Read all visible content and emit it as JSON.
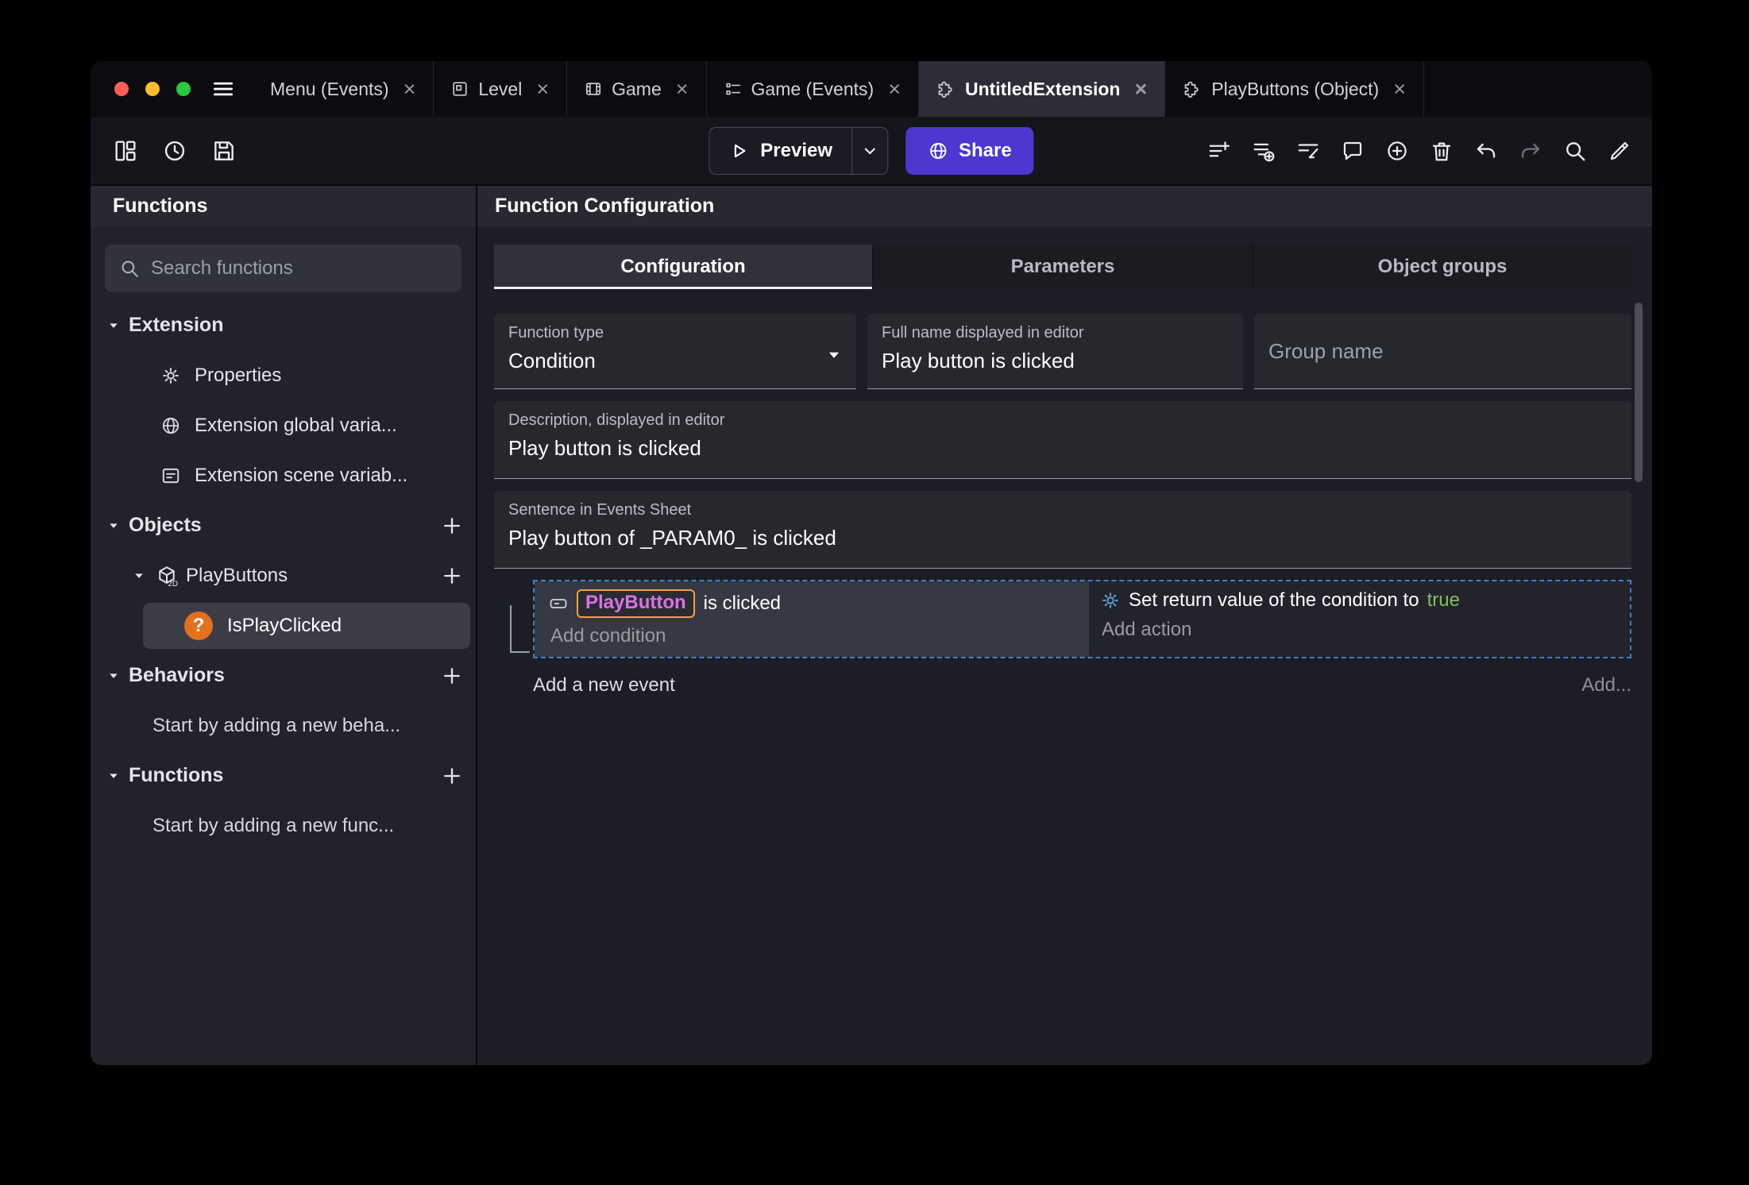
{
  "glyphs": {
    "close": "×",
    "question": "?",
    "two_d": "2D"
  },
  "colors": {
    "accent": "#4A38D0",
    "selection_blue": "#4A90D9",
    "chip_border": "#EEA43E",
    "chip_text": "#D873E2",
    "true_green": "#7FC05F"
  },
  "titlebar": {
    "tabs": [
      {
        "label": "Menu (Events)"
      },
      {
        "label": "Level"
      },
      {
        "label": "Game"
      },
      {
        "label": "Game (Events)"
      },
      {
        "label": "UntitledExtension"
      },
      {
        "label": "PlayButtons (Object)"
      }
    ]
  },
  "toolbar": {
    "preview": "Preview",
    "share": "Share"
  },
  "sidebar": {
    "header": "Functions",
    "search_placeholder": "Search functions",
    "tree": {
      "extension": "Extension",
      "properties": "Properties",
      "global_vars": "Extension global varia...",
      "scene_vars": "Extension scene variab...",
      "objects": "Objects",
      "playbuttons": "PlayButtons",
      "isplayclicked": "IsPlayClicked",
      "behaviors": "Behaviors",
      "behaviors_empty": "Start by adding a new beha...",
      "functions": "Functions",
      "functions_empty": "Start by adding a new func..."
    }
  },
  "main": {
    "header": "Function Configuration",
    "tabs": {
      "configuration": "Configuration",
      "parameters": "Parameters",
      "object_groups": "Object groups"
    },
    "fields": {
      "function_type_label": "Function type",
      "function_type_value": "Condition",
      "full_name_label": "Full name displayed in editor",
      "full_name_value": "Play button is clicked",
      "group_name_placeholder": "Group name",
      "description_label": "Description, displayed in editor",
      "description_value": "Play button is clicked",
      "sentence_label": "Sentence in Events Sheet",
      "sentence_value": "Play button of _PARAM0_ is clicked"
    },
    "events": {
      "condition_object": "PlayButton",
      "condition_suffix": "is clicked",
      "add_condition": "Add condition",
      "action_prefix": "Set return value of the condition to",
      "action_value": "true",
      "add_action": "Add action",
      "add_new_event": "Add a new event",
      "add_button": "Add..."
    }
  }
}
